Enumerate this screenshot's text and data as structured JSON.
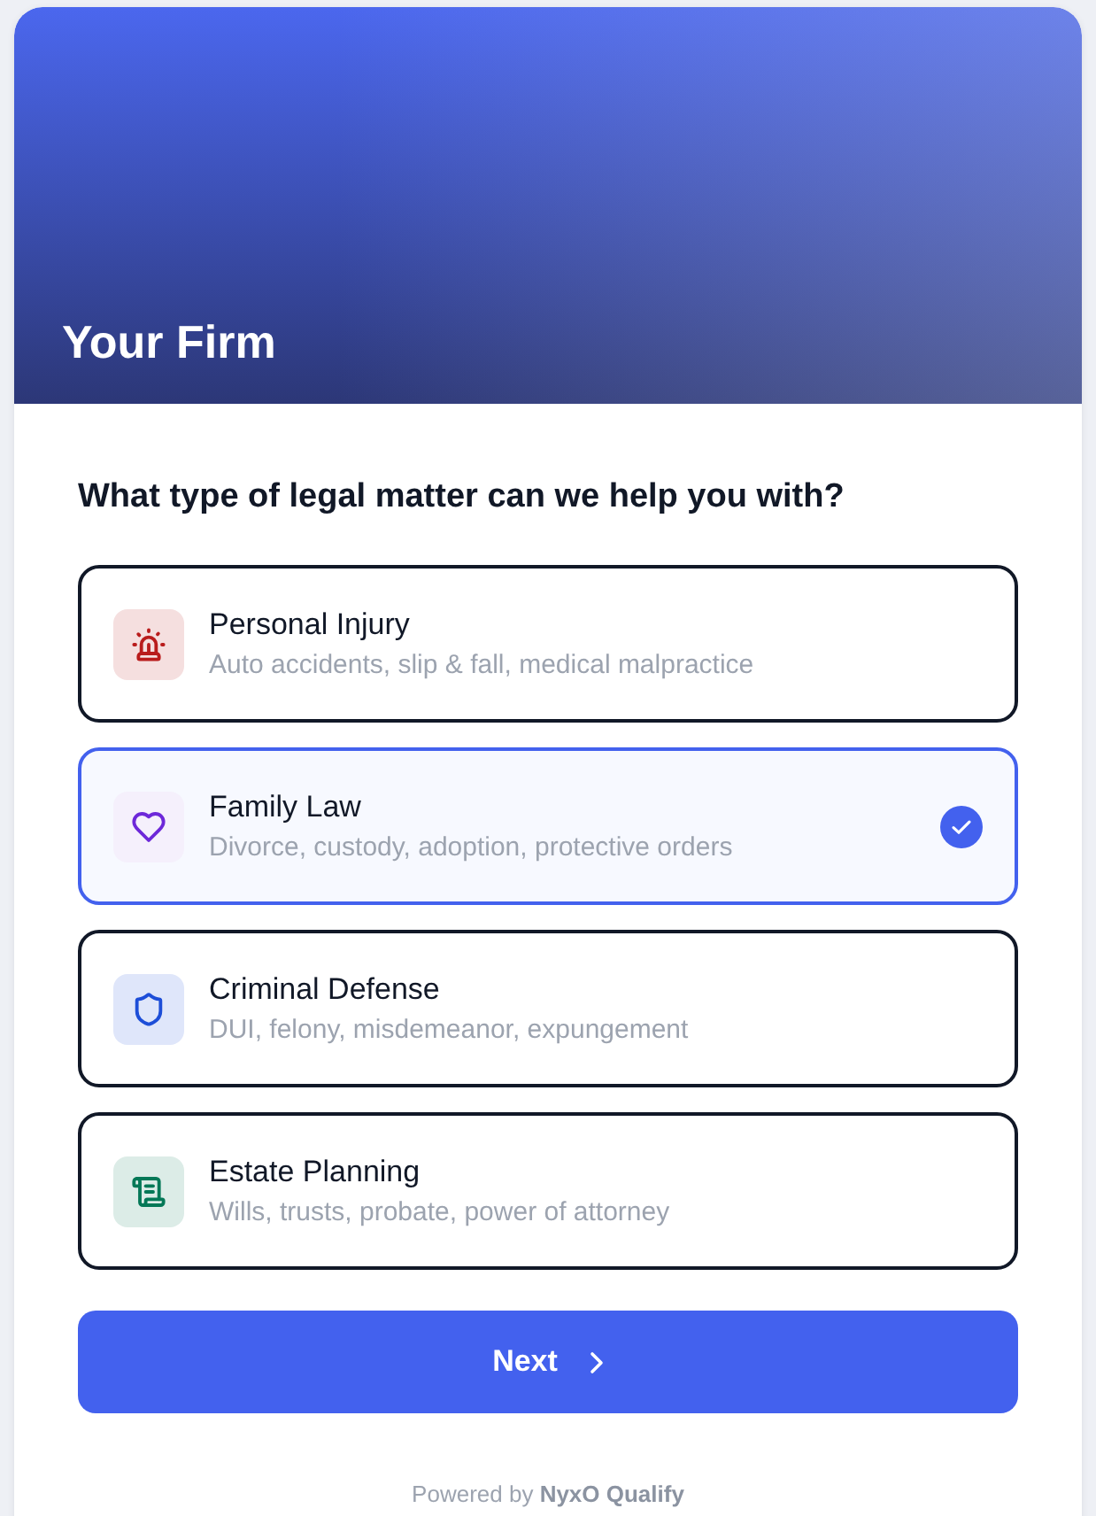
{
  "header": {
    "title": "Your Firm"
  },
  "question": "What type of legal matter can we help you with?",
  "options": [
    {
      "title": "Personal Injury",
      "description": "Auto accidents, slip & fall, medical malpractice",
      "color": "#b91c1c",
      "selected": false
    },
    {
      "title": "Family Law",
      "description": "Divorce, custody, adoption, protective orders",
      "color": "#6d28d9",
      "selected": true
    },
    {
      "title": "Criminal Defense",
      "description": "DUI, felony, misdemeanor, expungement",
      "color": "#1d4ed8",
      "selected": false
    },
    {
      "title": "Estate Planning",
      "description": "Wills, trusts, probate, power of attorney",
      "color": "#047857",
      "selected": false
    }
  ],
  "next_button": {
    "label": "Next"
  },
  "footer": "Powered by **NyxO Qualify**"
}
